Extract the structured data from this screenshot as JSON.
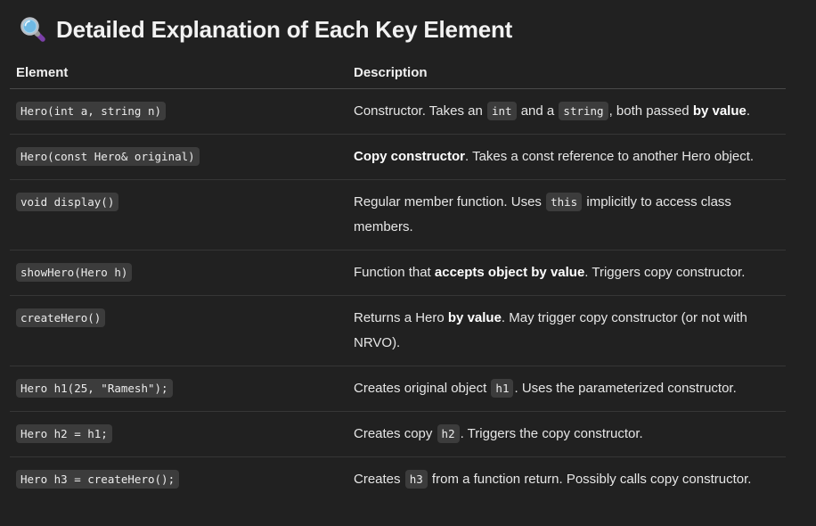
{
  "heading": {
    "icon": "magnifying-glass-icon",
    "title": "Detailed Explanation of Each Key Element"
  },
  "table": {
    "headers": [
      "Element",
      "Description"
    ],
    "rows": [
      {
        "element": "Hero(int a, string n)",
        "description": [
          {
            "t": "text",
            "v": "Constructor. Takes an "
          },
          {
            "t": "code",
            "v": "int"
          },
          {
            "t": "text",
            "v": " and a "
          },
          {
            "t": "code",
            "v": "string"
          },
          {
            "t": "text",
            "v": ", both passed "
          },
          {
            "t": "bold",
            "v": "by value"
          },
          {
            "t": "text",
            "v": "."
          }
        ]
      },
      {
        "element": "Hero(const Hero& original)",
        "description": [
          {
            "t": "bold",
            "v": "Copy constructor"
          },
          {
            "t": "text",
            "v": ". Takes a const reference to another Hero object."
          }
        ]
      },
      {
        "element": "void display()",
        "description": [
          {
            "t": "text",
            "v": "Regular member function. Uses "
          },
          {
            "t": "code",
            "v": "this"
          },
          {
            "t": "text",
            "v": " implicitly to access class members."
          }
        ]
      },
      {
        "element": "showHero(Hero h)",
        "description": [
          {
            "t": "text",
            "v": "Function that "
          },
          {
            "t": "bold",
            "v": "accepts object by value"
          },
          {
            "t": "text",
            "v": ". Triggers copy constructor."
          }
        ]
      },
      {
        "element": "createHero()",
        "description": [
          {
            "t": "text",
            "v": "Returns a Hero "
          },
          {
            "t": "bold",
            "v": "by value"
          },
          {
            "t": "text",
            "v": ". May trigger copy constructor (or not with NRVO)."
          }
        ]
      },
      {
        "element": "Hero h1(25, \"Ramesh\");",
        "description": [
          {
            "t": "text",
            "v": "Creates original object "
          },
          {
            "t": "code",
            "v": "h1"
          },
          {
            "t": "text",
            "v": ". Uses the parameterized constructor."
          }
        ]
      },
      {
        "element": "Hero h2 = h1;",
        "description": [
          {
            "t": "text",
            "v": "Creates copy "
          },
          {
            "t": "code",
            "v": "h2"
          },
          {
            "t": "text",
            "v": ". Triggers the copy constructor."
          }
        ]
      },
      {
        "element": "Hero h3 = createHero();",
        "description": [
          {
            "t": "text",
            "v": "Creates "
          },
          {
            "t": "code",
            "v": "h3"
          },
          {
            "t": "text",
            "v": " from a function return. Possibly calls copy constructor."
          }
        ]
      }
    ]
  }
}
